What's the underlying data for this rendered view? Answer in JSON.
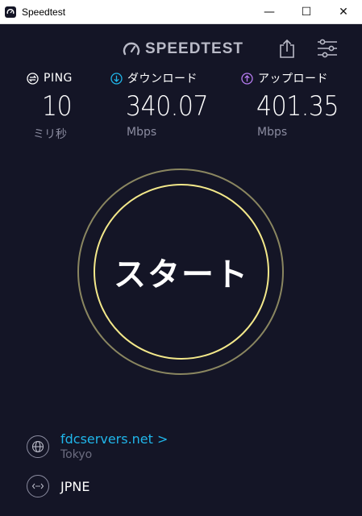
{
  "window": {
    "title": "Speedtest",
    "minimize_glyph": "—",
    "maximize_glyph": "☐",
    "close_glyph": "✕"
  },
  "header": {
    "brand": "SPEEDTEST",
    "brand_icon": "speedometer-icon",
    "share_icon": "share-icon",
    "settings_icon": "sliders-icon"
  },
  "metrics": {
    "ping": {
      "label": "PING",
      "value": "10",
      "unit": "ミリ秒",
      "icon": "ping-icon"
    },
    "download": {
      "label": "ダウンロード",
      "value": "340.07",
      "unit": "Mbps",
      "icon": "download-icon",
      "color": "#20b6ea"
    },
    "upload": {
      "label": "アップロード",
      "value": "401.35",
      "unit": "Mbps",
      "icon": "upload-icon",
      "color": "#b77cf2"
    }
  },
  "start": {
    "label": "スタート"
  },
  "server": {
    "name": "fdcservers.net",
    "chevron": ">",
    "location": "Tokyo",
    "icon": "globe-icon"
  },
  "isp": {
    "name": "JPNE",
    "icon": "connection-icon"
  },
  "colors": {
    "background": "#141526",
    "accent_blue": "#20b6ea",
    "accent_purple": "#b77cf2",
    "ring_gold": "#f3e88a"
  }
}
